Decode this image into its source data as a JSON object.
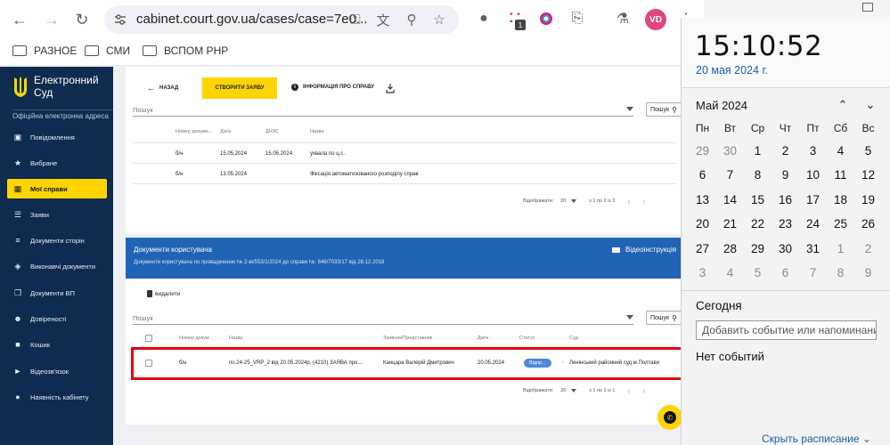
{
  "browser": {
    "url": "cabinet.court.gov.ua/cases/case=7e0...",
    "avatar_initials": "VD",
    "ext_badge": "1",
    "bookmarks": [
      "РАЗНОЕ",
      "СМИ",
      "ВСПОМ PHP"
    ]
  },
  "sidebar": {
    "brand_title": "Електронний Суд",
    "brand_sub": "Офіційна електронна адреса",
    "items": [
      {
        "label": "Повідомлення",
        "icon": "message-icon"
      },
      {
        "label": "Вибране",
        "icon": "star-icon"
      },
      {
        "label": "Мої справи",
        "icon": "folder-icon"
      },
      {
        "label": "Заяви",
        "icon": "list-icon"
      },
      {
        "label": "Документи сторін",
        "icon": "documents-icon"
      },
      {
        "label": "Виконавчі документи",
        "icon": "layers-icon"
      },
      {
        "label": "Документи ВП",
        "icon": "copy-icon"
      },
      {
        "label": "Довіреності",
        "icon": "people-icon"
      },
      {
        "label": "Кошик",
        "icon": "trash-icon"
      },
      {
        "label": "Відеозв'язок",
        "icon": "video-icon"
      },
      {
        "label": "Наявність кабінету",
        "icon": "person-icon"
      }
    ]
  },
  "case_card": {
    "back_label": "НАЗАД",
    "create_label": "СТВОРИТИ ЗАЯВУ",
    "info_label": "ІНФОРМАЦІЯ ПРО СПРАВУ",
    "search_placeholder": "Пошук",
    "search_button": "Пошук",
    "columns": [
      "Номер докуме...",
      "Дата",
      "ДНЗС",
      "Назва"
    ],
    "rows": [
      [
        "б/н",
        "15.05.2024",
        "15.05.2024",
        "ухвала по ц.с."
      ],
      [
        "б/н",
        "13.05.2024",
        "",
        "Фіксація автоматизованого розподілу справ"
      ]
    ],
    "pager": {
      "label": "Відображати:",
      "per_page": "20",
      "range": "з 1 по 2 із 2"
    }
  },
  "user_docs": {
    "title": "Документи користувача",
    "subtitle": "Документи користувача по провадженню № 2-ві/553/1/2024 до справи №: 646/7033/17 від 28.12.2018",
    "video_label": "Відеоінструкція",
    "delete_label": "видалити",
    "search_placeholder": "Пошук",
    "search_button": "Пошук",
    "columns": [
      "Номер докум...",
      "Назва",
      "Заявник/Представник",
      "Дата",
      "Статус",
      "Суд"
    ],
    "rows": [
      {
        "number": "б/н",
        "name": "по.24-25_VRP_2 від 20.05.2024р. (4210) ЗАЯВА про...",
        "applicant": "Канцара Валерій Дмитрович",
        "date": "20.05.2024",
        "status": "Відпр...",
        "status_extra": ".",
        "court": "Ленінський районний суд м.Полтави"
      }
    ],
    "pager": {
      "label": "Відображати:",
      "per_page": "20",
      "range": "з 1 по 1 із 1"
    }
  },
  "calendar": {
    "time": "15:10:52",
    "date_long": "20 мая 2024 г.",
    "month_title": "Май 2024",
    "weekdays": [
      "Пн",
      "Вт",
      "Ср",
      "Чт",
      "Пт",
      "Сб",
      "Вс"
    ],
    "weeks": [
      [
        "29",
        "30",
        "1",
        "2",
        "3",
        "4",
        "5"
      ],
      [
        "6",
        "7",
        "8",
        "9",
        "10",
        "11",
        "12"
      ],
      [
        "13",
        "14",
        "15",
        "16",
        "17",
        "18",
        "19"
      ],
      [
        "20",
        "21",
        "22",
        "23",
        "24",
        "25",
        "26"
      ],
      [
        "27",
        "28",
        "29",
        "30",
        "31",
        "1",
        "2"
      ],
      [
        "3",
        "4",
        "5",
        "6",
        "7",
        "8",
        "9"
      ]
    ],
    "today_label": "Сегодня",
    "event_placeholder": "Добавить событие или напоминание",
    "no_events": "Нет событий",
    "hide_schedule": "Скрыть расписание"
  },
  "colors": {
    "accent": "#ffd400",
    "sidebar": "#0d2c4f",
    "header_blue": "#1f64b5",
    "highlight": "#e30613"
  }
}
